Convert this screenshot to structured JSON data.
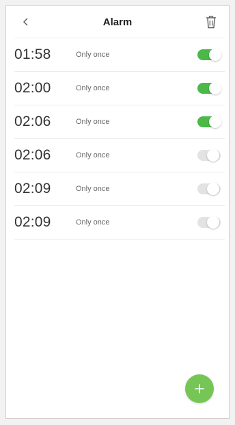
{
  "header": {
    "title": "Alarm"
  },
  "alarms": [
    {
      "time": "01:58",
      "repeat": "Only once",
      "enabled": true
    },
    {
      "time": "02:00",
      "repeat": "Only once",
      "enabled": true
    },
    {
      "time": "02:06",
      "repeat": "Only once",
      "enabled": true
    },
    {
      "time": "02:06",
      "repeat": "Only once",
      "enabled": false
    },
    {
      "time": "02:09",
      "repeat": "Only once",
      "enabled": false
    },
    {
      "time": "02:09",
      "repeat": "Only once",
      "enabled": false
    }
  ],
  "icons": {
    "back": "chevron-left-icon",
    "delete": "trash-icon",
    "add": "plus-icon"
  },
  "colors": {
    "toggle_on": "#4cb848",
    "toggle_off": "#e3e3e3",
    "fab": "#76c657"
  }
}
